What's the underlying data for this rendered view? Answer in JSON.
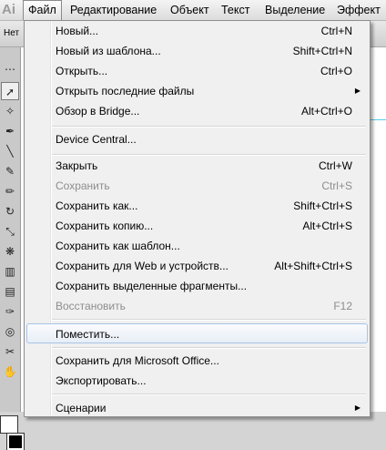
{
  "app": {
    "logo": "Ai"
  },
  "menubar": {
    "items": [
      "Файл",
      "Редактирование",
      "Объект",
      "Текст",
      "Выделение",
      "Эффект"
    ]
  },
  "control_bar": {
    "label": "Нет"
  },
  "file_menu": {
    "items": [
      {
        "label": "Новый...",
        "shortcut": "Ctrl+N"
      },
      {
        "label": "Новый из шаблона...",
        "shortcut": "Shift+Ctrl+N"
      },
      {
        "label": "Открыть...",
        "shortcut": "Ctrl+O"
      },
      {
        "label": "Открыть последние файлы",
        "shortcut": ""
      },
      {
        "label": "Обзор в Bridge...",
        "shortcut": "Alt+Ctrl+O"
      },
      {
        "label": "Device Central...",
        "shortcut": ""
      },
      {
        "label": "Закрыть",
        "shortcut": "Ctrl+W"
      },
      {
        "label": "Сохранить",
        "shortcut": "Ctrl+S"
      },
      {
        "label": "Сохранить как...",
        "shortcut": "Shift+Ctrl+S"
      },
      {
        "label": "Сохранить копию...",
        "shortcut": "Alt+Ctrl+S"
      },
      {
        "label": "Сохранить как шаблон...",
        "shortcut": ""
      },
      {
        "label": "Сохранить для Web и устройств...",
        "shortcut": "Alt+Shift+Ctrl+S"
      },
      {
        "label": "Сохранить выделенные фрагменты...",
        "shortcut": ""
      },
      {
        "label": "Восстановить",
        "shortcut": "F12"
      },
      {
        "label": "Поместить...",
        "shortcut": ""
      },
      {
        "label": "Сохранить для Microsoft Office...",
        "shortcut": ""
      },
      {
        "label": "Экспортировать...",
        "shortcut": ""
      },
      {
        "label": "Сценарии",
        "shortcut": ""
      }
    ]
  }
}
